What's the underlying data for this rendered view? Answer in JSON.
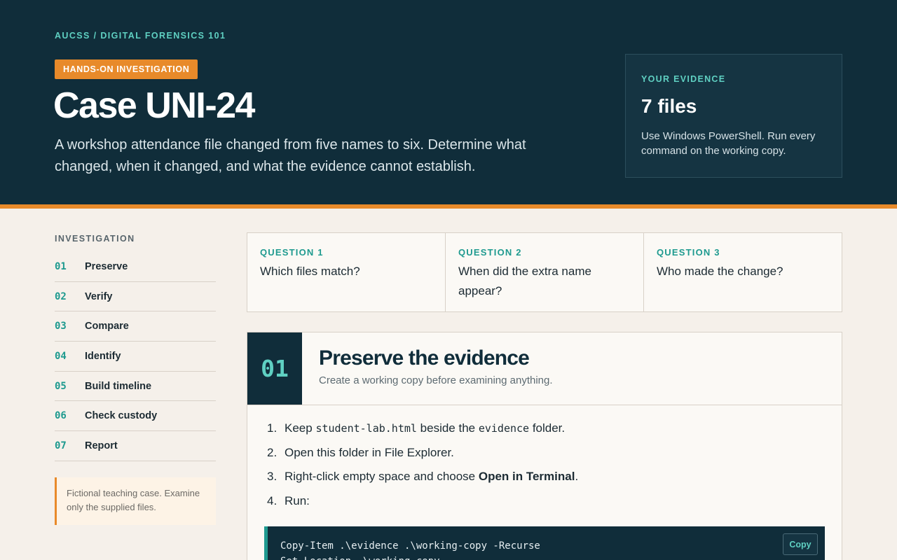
{
  "hero": {
    "breadcrumb": "AUCSS / DIGITAL FORENSICS 101",
    "badge": "HANDS-ON INVESTIGATION",
    "title": "Case UNI-24",
    "subtitle": "A workshop attendance file changed from five names to six. Determine what changed, when it changed, and what the evidence cannot establish."
  },
  "evidence": {
    "label": "YOUR EVIDENCE",
    "count": "7 files",
    "note": "Use Windows PowerShell. Run every command on the working copy."
  },
  "sidebar": {
    "label": "INVESTIGATION",
    "items": [
      {
        "num": "01",
        "label": "Preserve"
      },
      {
        "num": "02",
        "label": "Verify"
      },
      {
        "num": "03",
        "label": "Compare"
      },
      {
        "num": "04",
        "label": "Identify"
      },
      {
        "num": "05",
        "label": "Build timeline"
      },
      {
        "num": "06",
        "label": "Check custody"
      },
      {
        "num": "07",
        "label": "Report"
      }
    ],
    "note": "Fictional teaching case. Examine only the supplied files."
  },
  "questions": [
    {
      "label": "QUESTION 1",
      "text": "Which files match?"
    },
    {
      "label": "QUESTION 2",
      "text": "When did the extra name appear?"
    },
    {
      "label": "QUESTION 3",
      "text": "Who made the change?"
    }
  ],
  "step": {
    "num": "01",
    "title": "Preserve the evidence",
    "subtitle": "Create a working copy before examining anything.",
    "instructions": {
      "n1": "1.",
      "s1a": "Keep ",
      "s1b": "student-lab.html",
      "s1c": " beside the ",
      "s1d": "evidence",
      "s1e": " folder.",
      "n2": "2.",
      "s2": "Open this folder in File Explorer.",
      "n3": "3.",
      "s3a": "Right-click empty space and choose ",
      "s3b": "Open in Terminal",
      "s3c": ".",
      "n4": "4.",
      "s4": "Run:"
    },
    "code": "Copy-Item .\\evidence .\\working-copy -Recurse\nSet-Location .\\working-copy",
    "copy_label": "Copy"
  },
  "colors": {
    "navy": "#102d3a",
    "accent_orange": "#e88a2a",
    "teal": "#1e9a8f",
    "light_teal": "#5fd0c2",
    "background": "#f5f0ea"
  }
}
